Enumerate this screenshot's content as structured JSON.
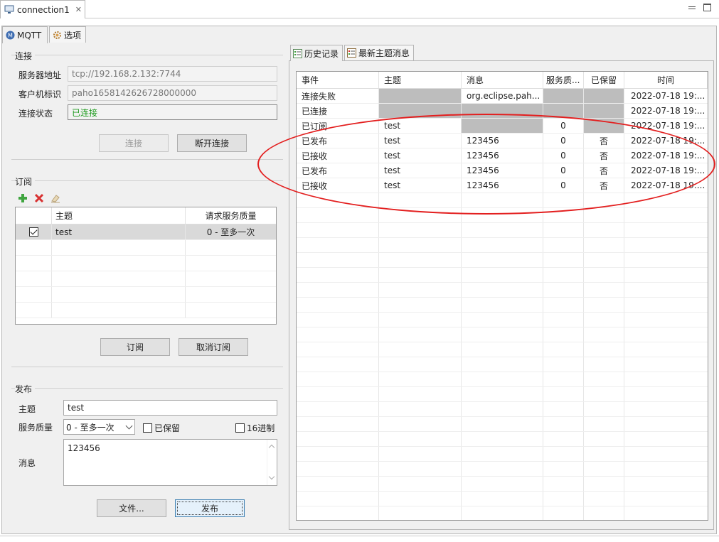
{
  "editor_tab": {
    "title": "connection1",
    "close": "✕"
  },
  "outer_tabs": [
    {
      "label": "MQTT"
    },
    {
      "label": "选项"
    }
  ],
  "connect": {
    "group_title": "连接",
    "server_label": "服务器地址",
    "server_value": "tcp://192.168.2.132:7744",
    "client_label": "客户机标识",
    "client_value": "paho1658142626728000000",
    "status_label": "连接状态",
    "status_value": "已连接",
    "connect_btn": "连接",
    "disconnect_btn": "断开连接"
  },
  "subscribe": {
    "group_title": "订阅",
    "columns": [
      "",
      "主题",
      "请求服务质量"
    ],
    "rows": [
      {
        "checked": true,
        "topic": "test",
        "qos": "0 - 至多一次"
      }
    ],
    "subscribe_btn": "订阅",
    "unsubscribe_btn": "取消订阅"
  },
  "publish": {
    "group_title": "发布",
    "topic_label": "主题",
    "topic_value": "test",
    "qos_label": "服务质量",
    "qos_value": "0 - 至多一次",
    "retained_label": "已保留",
    "hex_label": "16进制",
    "message_label": "消息",
    "message_value": "123456",
    "file_btn": "文件...",
    "publish_btn": "发布"
  },
  "right_tabs": [
    {
      "label": "历史记录"
    },
    {
      "label": "最新主题消息"
    }
  ],
  "history": {
    "columns": [
      "事件",
      "主题",
      "消息",
      "服务质...",
      "已保留",
      "时间"
    ],
    "rows": [
      {
        "event": "连接失败",
        "topic": "",
        "message": "org.eclipse.pah...",
        "qos": "",
        "retained": "",
        "time": "2022-07-18 19:...",
        "gray": [
          1,
          3,
          4
        ]
      },
      {
        "event": "已连接",
        "topic": "",
        "message": "",
        "qos": "",
        "retained": "",
        "time": "2022-07-18 19:...",
        "gray": [
          1,
          2,
          3,
          4
        ]
      },
      {
        "event": "已订阅",
        "topic": "test",
        "message": "",
        "qos": "0",
        "retained": "",
        "time": "2022-07-18 19:...",
        "gray": [
          2,
          4
        ]
      },
      {
        "event": "已发布",
        "topic": "test",
        "message": "123456",
        "qos": "0",
        "retained": "否",
        "time": "2022-07-18 19:...",
        "gray": []
      },
      {
        "event": "已接收",
        "topic": "test",
        "message": "123456",
        "qos": "0",
        "retained": "否",
        "time": "2022-07-18 19:...",
        "gray": []
      },
      {
        "event": "已发布",
        "topic": "test",
        "message": "123456",
        "qos": "0",
        "retained": "否",
        "time": "2022-07-18 19:...",
        "gray": []
      },
      {
        "event": "已接收",
        "topic": "test",
        "message": "123456",
        "qos": "0",
        "retained": "否",
        "time": "2022-07-18 19:...",
        "gray": []
      }
    ]
  },
  "colors": {
    "status_green": "#1c9a1c",
    "highlight_ellipse": "#e31f1f",
    "gray_cell": "#bdbdbd"
  }
}
